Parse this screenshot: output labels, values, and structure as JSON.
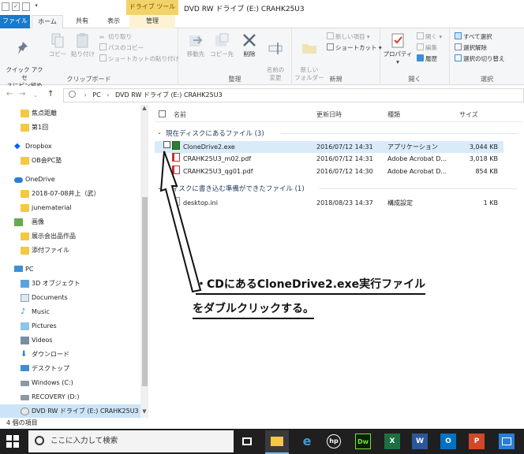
{
  "window": {
    "title": "DVD RW ドライブ (E:) CRAHK25U3",
    "context_tab_header": "ドライブ ツール"
  },
  "tabs": {
    "file": "ファイル",
    "home": "ホーム",
    "share": "共有",
    "view": "表示",
    "manage": "管理"
  },
  "ribbon": {
    "clipboard": {
      "label": "クリップボード",
      "pin": "クイック アクセ\nスにピン留め",
      "copy": "コピー",
      "paste": "貼り付け",
      "cut": "切り取り",
      "copy_path": "パスのコピー",
      "paste_shortcut": "ショートカットの貼り付け"
    },
    "organize": {
      "label": "整理",
      "move_to": "移動先",
      "copy_to": "コピー先",
      "delete": "削除",
      "rename": "名前の\n変更"
    },
    "new": {
      "label": "新規",
      "new_folder": "新しい\nフォルダー",
      "new_item": "新しい項目",
      "shortcut": "ショートカット"
    },
    "open": {
      "label": "開く",
      "properties": "プロパティ",
      "open": "開く",
      "edit": "編集",
      "history": "履歴"
    },
    "select": {
      "label": "選択",
      "select_all": "すべて選択",
      "select_none": "選択解除",
      "invert": "選択の切り替え"
    }
  },
  "address": {
    "crumbs": [
      "PC",
      "DVD RW ドライブ (E:) CRAHK25U3"
    ]
  },
  "sidebar": {
    "items": [
      {
        "label": "焦点距離"
      },
      {
        "label": "第1回"
      },
      {
        "label": "Dropbox"
      },
      {
        "label": "OB会PC塾"
      },
      {
        "label": "OneDrive"
      },
      {
        "label": "2018-07-08井上（武）"
      },
      {
        "label": "junematerial"
      },
      {
        "label": "画像"
      },
      {
        "label": "展示会出品作品"
      },
      {
        "label": "添付ファイル"
      },
      {
        "label": "PC"
      },
      {
        "label": "3D オブジェクト"
      },
      {
        "label": "Documents"
      },
      {
        "label": "Music"
      },
      {
        "label": "Pictures"
      },
      {
        "label": "Videos"
      },
      {
        "label": "ダウンロード"
      },
      {
        "label": "デスクトップ"
      },
      {
        "label": "Windows (C:)"
      },
      {
        "label": "RECOVERY (D:)"
      },
      {
        "label": "DVD RW ドライブ (E:) CRAHK25U3"
      }
    ]
  },
  "columns": {
    "name": "名前",
    "modified": "更新日時",
    "type": "種類",
    "size": "サイズ"
  },
  "groups": [
    {
      "title": "現在ディスクにあるファイル (3)",
      "files": [
        {
          "name": "CloneDrive2.exe",
          "modified": "2016/07/12 14:31",
          "type": "アプリケーション",
          "size": "3,044 KB"
        },
        {
          "name": "CRAHK25U3_m02.pdf",
          "modified": "2016/07/12 14:31",
          "type": "Adobe Acrobat D...",
          "size": "3,018 KB"
        },
        {
          "name": "CRAHK25U3_qg01.pdf",
          "modified": "2016/07/12 14:30",
          "type": "Adobe Acrobat D...",
          "size": "854 KB"
        }
      ]
    },
    {
      "title": "ディスクに書き込む準備ができたファイル (1)",
      "files": [
        {
          "name": "desktop.ini",
          "modified": "2018/08/23 14:37",
          "type": "構成設定",
          "size": "1 KB"
        }
      ]
    }
  ],
  "annotation": {
    "line1": "・CDにあるCloneDrive2.exe実行ファイル",
    "line2": "をダブルクリックする。"
  },
  "status": {
    "count": "4 個の項目"
  },
  "taskbar": {
    "search_placeholder": "ここに入力して検索",
    "apps": [
      "task-view",
      "file-explorer",
      "edge",
      "hp",
      "Dw",
      "X",
      "W",
      "O",
      "P",
      "photos"
    ]
  }
}
